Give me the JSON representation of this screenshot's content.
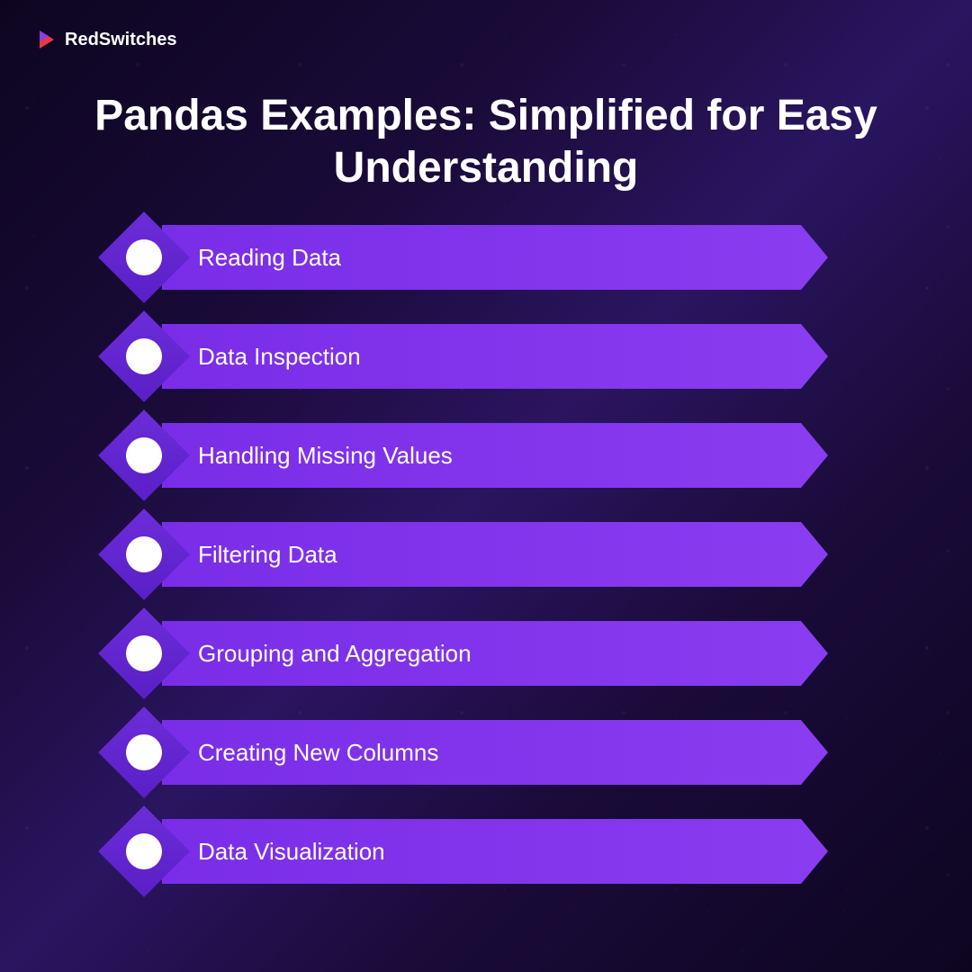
{
  "brand": {
    "name": "RedSwitches"
  },
  "title": "Pandas Examples: Simplified for Easy Understanding",
  "items": [
    {
      "label": "Reading Data"
    },
    {
      "label": "Data Inspection"
    },
    {
      "label": "Handling Missing Values"
    },
    {
      "label": "Filtering Data"
    },
    {
      "label": "Grouping and Aggregation"
    },
    {
      "label": "Creating New Columns"
    },
    {
      "label": "Data Visualization"
    }
  ],
  "colors": {
    "bar": "#7a2de8",
    "diamond": "#6b2dd9",
    "circle": "#ffffff",
    "text": "#ffffff"
  }
}
